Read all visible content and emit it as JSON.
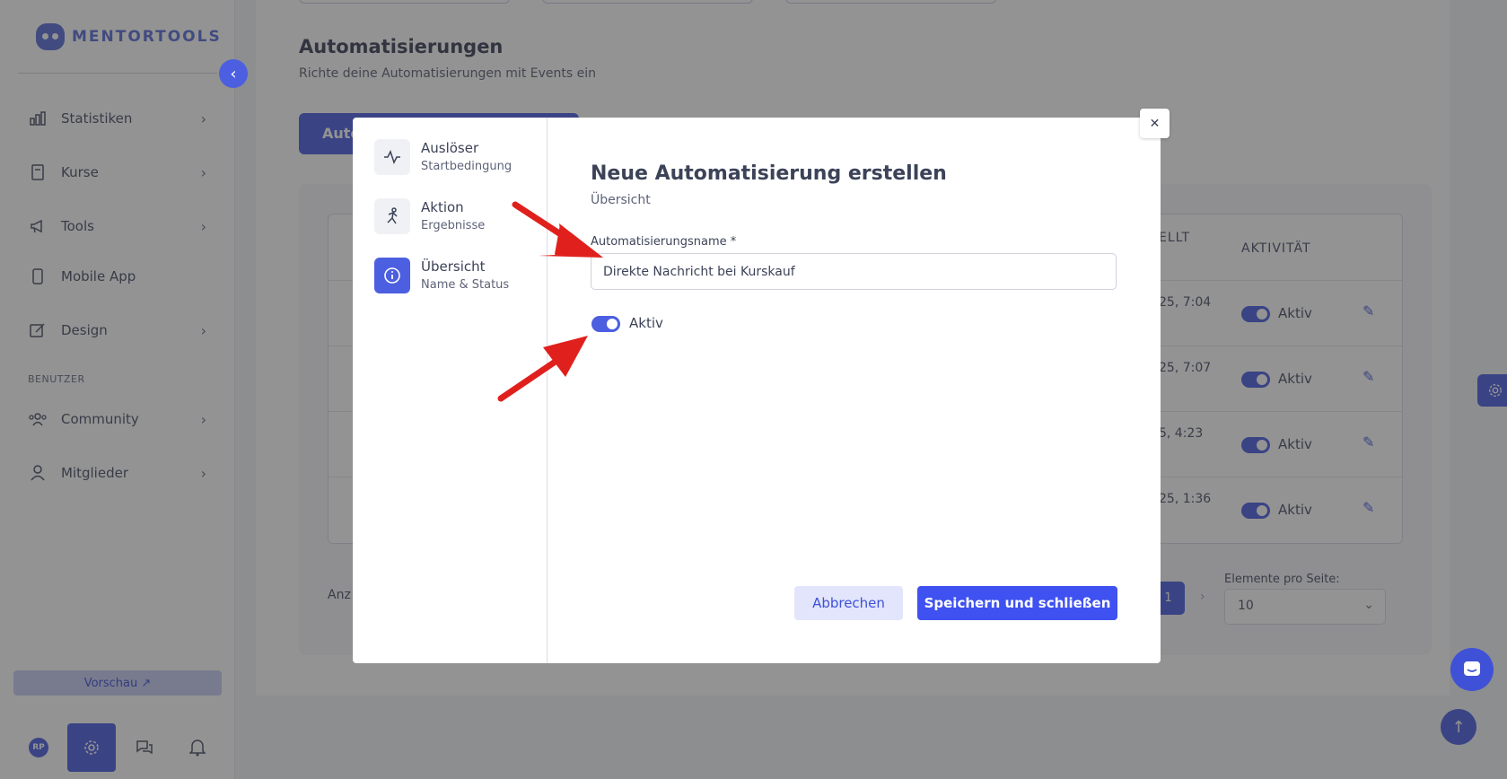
{
  "brand": {
    "name": "MENTORTOOLS"
  },
  "sidebar": {
    "items": [
      {
        "label": "Statistiken",
        "icon": "bar-chart-icon",
        "chevron": "›"
      },
      {
        "label": "Kurse",
        "icon": "book-icon",
        "chevron": "›"
      },
      {
        "label": "Tools",
        "icon": "megaphone-icon",
        "chevron": "›"
      },
      {
        "label": "Mobile App",
        "icon": "phone-icon"
      },
      {
        "label": "Design",
        "icon": "pencil-icon",
        "chevron": "›"
      },
      {
        "label": "Community",
        "icon": "people-icon",
        "chevron": "›"
      },
      {
        "label": "Mitglieder",
        "icon": "user-icon",
        "chevron": "›"
      }
    ],
    "section_label": "BENUTZER",
    "preview_label": "Vorschau ↗",
    "avatar_initials": "RP"
  },
  "main": {
    "title": "Automatisierungen",
    "subtitle": "Richte deine Automatisierungen mit Events ein",
    "create_button_label": "Auto",
    "table": {
      "headers": {
        "created": "ELLT",
        "activity": "AKTIVITÄT"
      },
      "rows": [
        {
          "edge": "",
          "date": "25, 7:04",
          "status": "Aktiv"
        },
        {
          "edge": "",
          "date": "25, 7:07",
          "status": "Aktiv"
        },
        {
          "edge": "",
          "date": "5, 4:23",
          "status": "Aktiv"
        },
        {
          "edge": "",
          "date": "25, 1:36",
          "status": "Aktiv"
        }
      ]
    },
    "footer_text": "Anz",
    "current_page": "1",
    "next_page_symbol": "›",
    "per_page_label": "Elemente pro Seite:",
    "per_page_value": "10"
  },
  "modal": {
    "steps": [
      {
        "title": "Auslöser",
        "subtitle": "Startbedingung",
        "icon": "pulse-icon"
      },
      {
        "title": "Aktion",
        "subtitle": "Ergebnisse",
        "icon": "running-person-icon"
      },
      {
        "title": "Übersicht",
        "subtitle": "Name & Status",
        "icon": "info-icon"
      }
    ],
    "title": "Neue Automatisierung erstellen",
    "subtitle": "Übersicht",
    "name_label": "Automatisierungsname *",
    "name_value": "Direkte Nachricht bei Kurskauf",
    "toggle_label": "Aktiv",
    "cancel_label": "Abbrechen",
    "save_label": "Speichern und schließen",
    "close_symbol": "✕"
  },
  "colors": {
    "accent": "#4c5fe0",
    "annotation_arrow": "#e0201c"
  }
}
